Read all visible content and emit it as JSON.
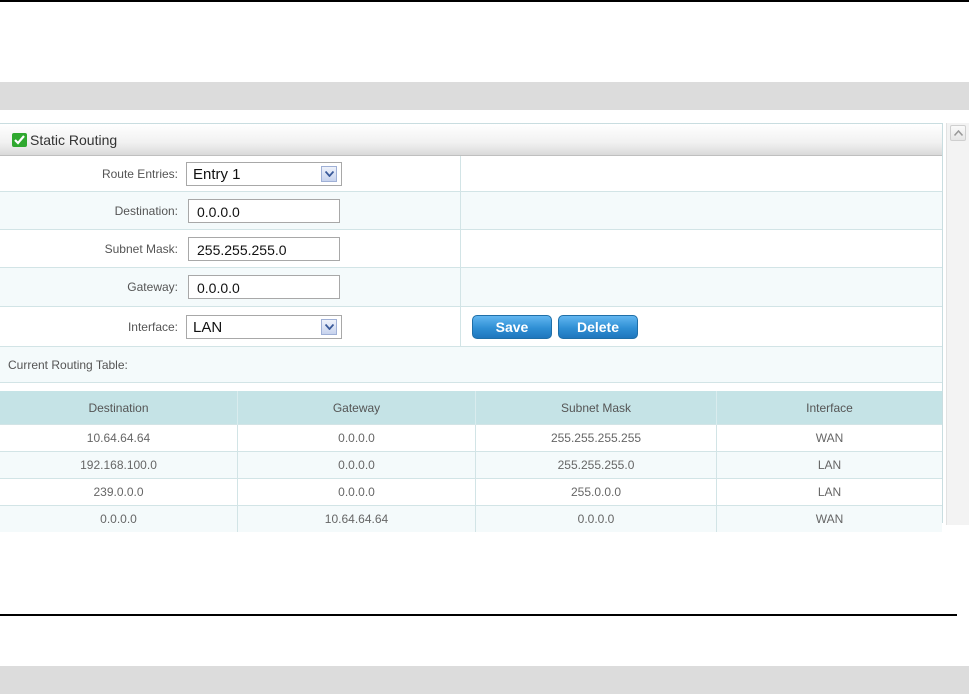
{
  "panel": {
    "title": "Static Routing",
    "icon": "check-box-icon"
  },
  "form": {
    "route_entries_label": "Route Entries:",
    "route_entries_value": "Entry 1",
    "destination_label": "Destination:",
    "destination_value": "0.0.0.0",
    "subnet_mask_label": "Subnet Mask:",
    "subnet_mask_value": "255.255.255.0",
    "gateway_label": "Gateway:",
    "gateway_value": "0.0.0.0",
    "interface_label": "Interface:",
    "interface_value": "LAN",
    "save_label": "Save",
    "delete_label": "Delete"
  },
  "routing_table": {
    "title": "Current Routing Table:",
    "headers": [
      "Destination",
      "Gateway",
      "Subnet Mask",
      "Interface"
    ],
    "rows": [
      [
        "10.64.64.64",
        "0.0.0.0",
        "255.255.255.255",
        "WAN"
      ],
      [
        "192.168.100.0",
        "0.0.0.0",
        "255.255.255.0",
        "LAN"
      ],
      [
        "239.0.0.0",
        "0.0.0.0",
        "255.0.0.0",
        "LAN"
      ],
      [
        "0.0.0.0",
        "10.64.64.64",
        "0.0.0.0",
        "WAN"
      ]
    ]
  },
  "colors": {
    "header_bg": "#c5e3e6",
    "button_blue": "#2f8fd4",
    "icon_green": "#2fa82f"
  }
}
